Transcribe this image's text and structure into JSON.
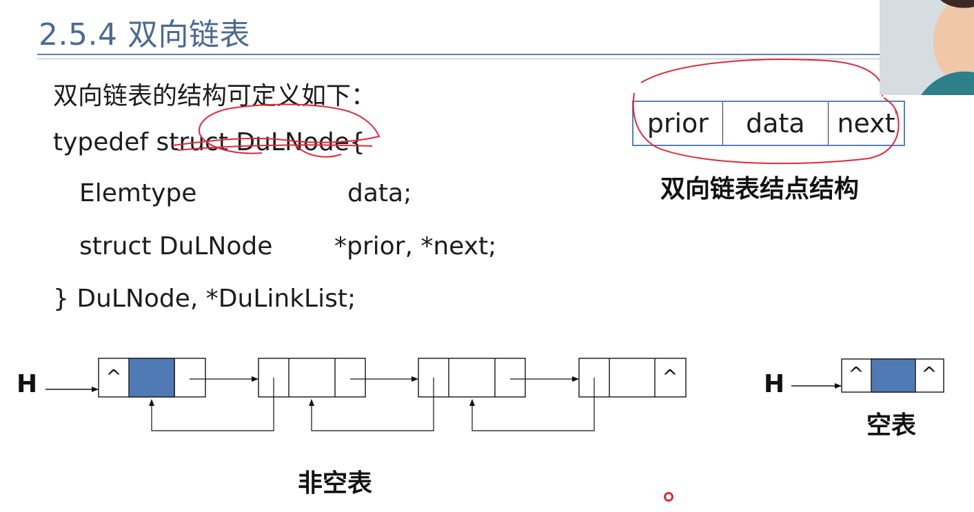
{
  "slide": {
    "title": "2.5.4 双向链表"
  },
  "code": {
    "intro": "双向链表的结构可定义如下：",
    "line1": "typedef struct DuLNode{",
    "line2_type": "Elemtype",
    "line2_field": "data;",
    "line3_type": "struct DuLNode",
    "line3_field": "*prior, *next;",
    "line4": "} DuLNode, *DuLinkList;"
  },
  "node_structure": {
    "fields": [
      "prior",
      "data",
      "next"
    ],
    "caption": "双向链表结点结构"
  },
  "diagram_nonempty": {
    "head_label": "H",
    "null_symbol": "^",
    "caption": "非空表"
  },
  "diagram_empty": {
    "head_label": "H",
    "null_symbol": "^",
    "caption": "空表"
  },
  "colors": {
    "title": "#4a6a94",
    "head_node_fill": "#4f7ab5",
    "annotation": "#e0283b"
  }
}
